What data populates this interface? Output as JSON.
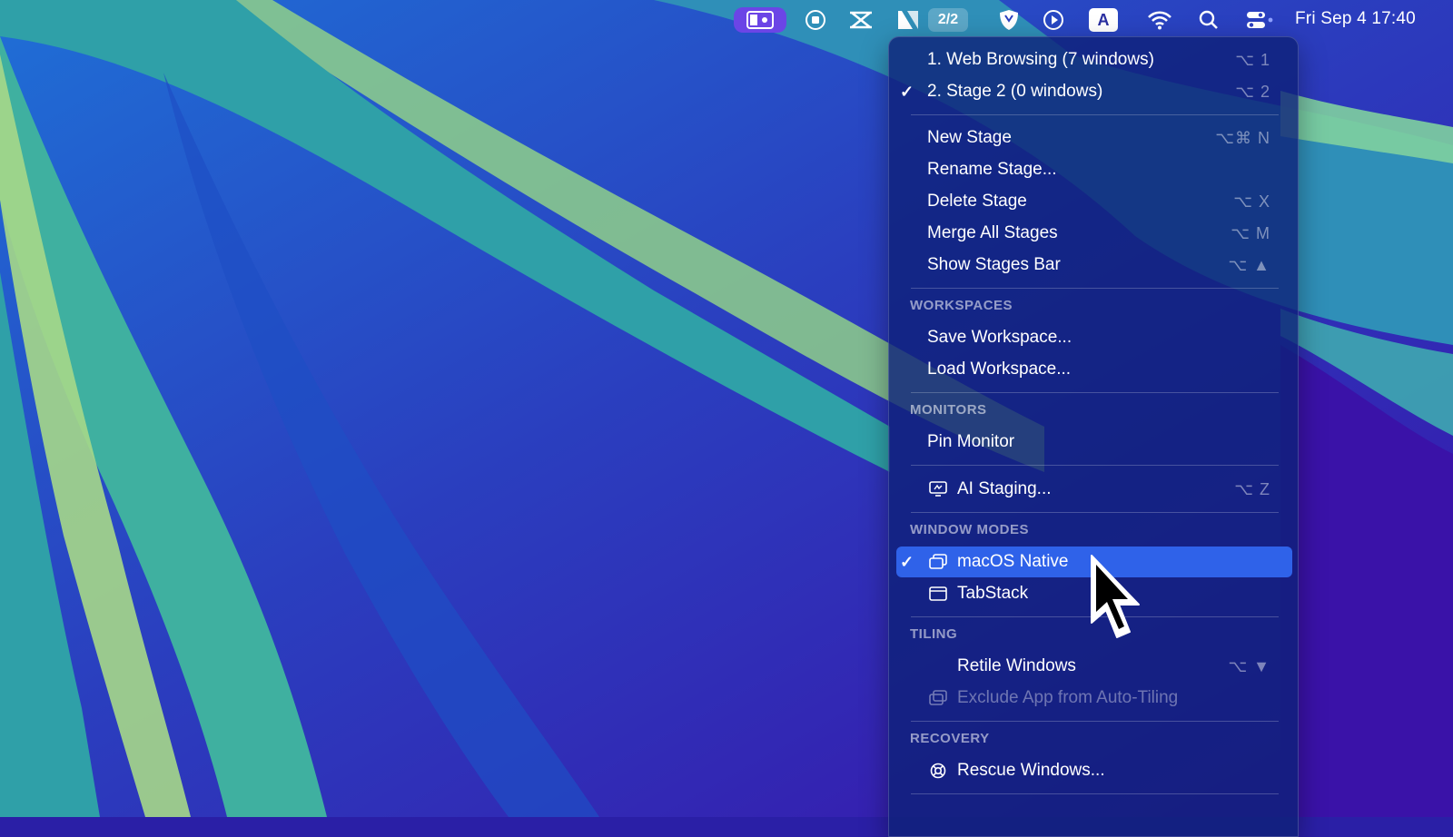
{
  "menubar": {
    "icons": [
      "stage-manager-icon",
      "record-icon",
      "crossed-arrows-icon",
      "stage-app-icon",
      "shield-icon",
      "play-icon",
      "keyboard-input-icon",
      "wifi-icon",
      "search-icon",
      "control-center-icon"
    ],
    "stage_count": "2/2",
    "keyboard_letter": "A",
    "clock": "Fri Sep 4  17:40"
  },
  "menu": {
    "stages": [
      {
        "label": "1. Web Browsing (7 windows)",
        "shortcut": "⌥ 1",
        "checked": false
      },
      {
        "label": "2. Stage 2 (0 windows)",
        "shortcut": "⌥ 2",
        "checked": true
      }
    ],
    "stage_actions": [
      {
        "label": "New Stage",
        "shortcut": "⌥⌘ N"
      },
      {
        "label": "Rename Stage...",
        "shortcut": ""
      },
      {
        "label": "Delete Stage",
        "shortcut": "⌥ X"
      },
      {
        "label": "Merge All Stages",
        "shortcut": "⌥ M"
      },
      {
        "label": "Show Stages Bar",
        "shortcut": "⌥ ▲"
      }
    ],
    "workspaces": {
      "header": "WORKSPACES",
      "items": [
        {
          "label": "Save Workspace..."
        },
        {
          "label": "Load Workspace..."
        }
      ]
    },
    "monitors": {
      "header": "MONITORS",
      "items": [
        {
          "label": "Pin Monitor"
        }
      ]
    },
    "ai_staging": {
      "label": "AI Staging...",
      "shortcut": "⌥ Z",
      "icon": "ai-staging-icon"
    },
    "window_modes": {
      "header": "WINDOW MODES",
      "items": [
        {
          "label": "macOS Native",
          "checked": true,
          "selected": true,
          "icon": "native-windows-icon"
        },
        {
          "label": "TabStack",
          "checked": false,
          "icon": "tabstack-icon"
        }
      ]
    },
    "tiling": {
      "header": "TILING",
      "items": [
        {
          "label": "Retile Windows",
          "shortcut": "⌥ ▼"
        },
        {
          "label": "Exclude App from Auto-Tiling",
          "disabled": true,
          "icon": "exclude-app-icon"
        }
      ]
    },
    "recovery": {
      "header": "RECOVERY",
      "items": [
        {
          "label": "Rescue Windows...",
          "icon": "lifebuoy-icon"
        }
      ]
    }
  },
  "colors": {
    "selection": "#2f62e9",
    "stage_manager_bg": "#6b45e6"
  }
}
